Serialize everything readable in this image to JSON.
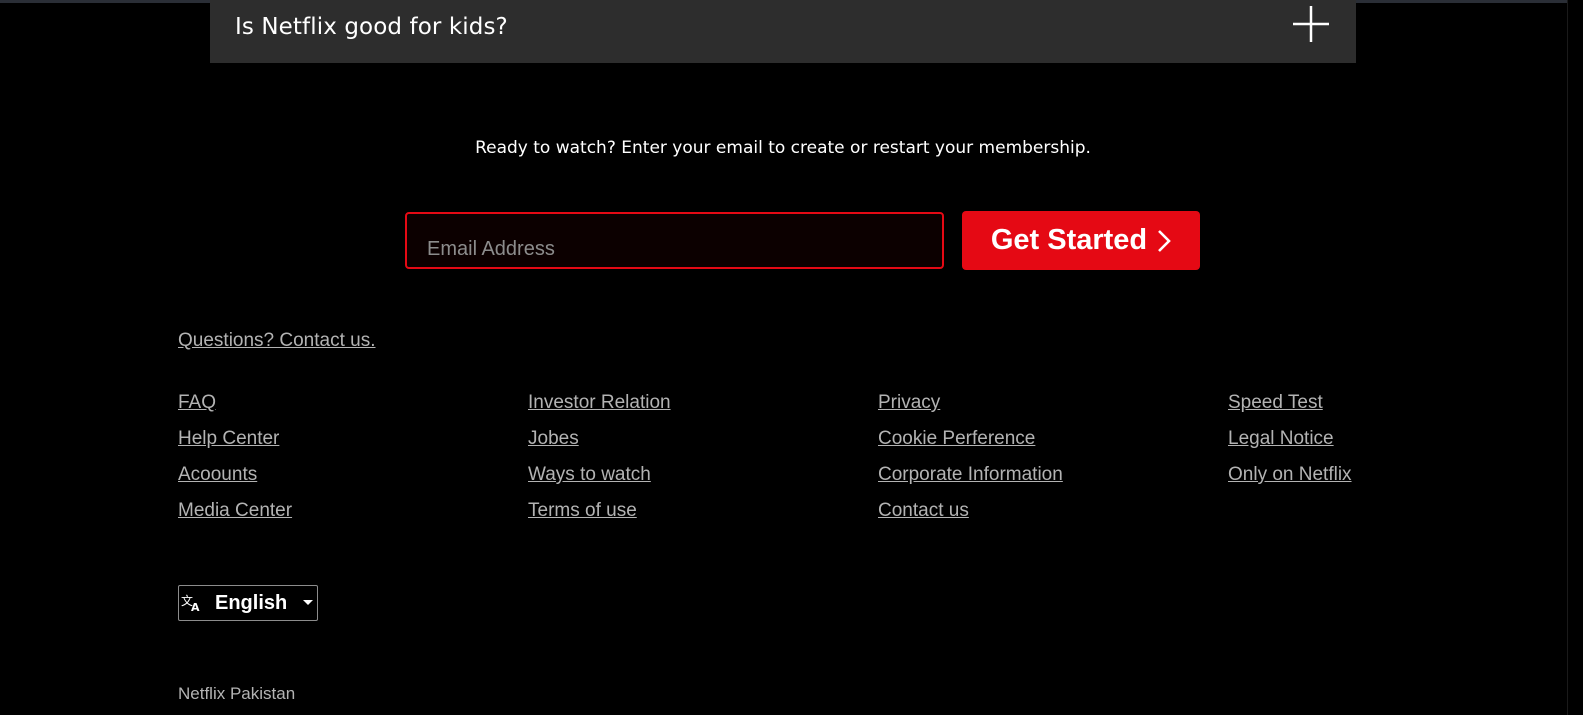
{
  "faq": {
    "question": "Is Netflix good for kids?",
    "expand_icon": "plus-icon"
  },
  "cta": {
    "text": "Ready to watch? Enter your email to create or restart your membership.",
    "email_placeholder": "Email Address",
    "email_value": "",
    "button_label": "Get Started",
    "button_icon": "chevron-right-icon"
  },
  "footer": {
    "questions_link": "Questions? Contact us.",
    "columns": [
      [
        "FAQ",
        "Help Center",
        "Acoounts",
        "Media Center"
      ],
      [
        "Investor Relation",
        "Jobes",
        "Ways to watch",
        "Terms of use"
      ],
      [
        "Privacy",
        "Cookie Perference",
        "Corporate Information",
        "Contact us"
      ],
      [
        "Speed Test",
        "Legal Notice",
        "Only on Netflix"
      ]
    ],
    "language": {
      "selected": "English",
      "icon": "language-icon",
      "caret_icon": "caret-down-icon"
    },
    "country": "Netflix Pakistan"
  },
  "colors": {
    "brand_red": "#e50914",
    "background": "#000000",
    "faq_background": "#2d2d2d",
    "link_grey": "#b3b3b3"
  }
}
